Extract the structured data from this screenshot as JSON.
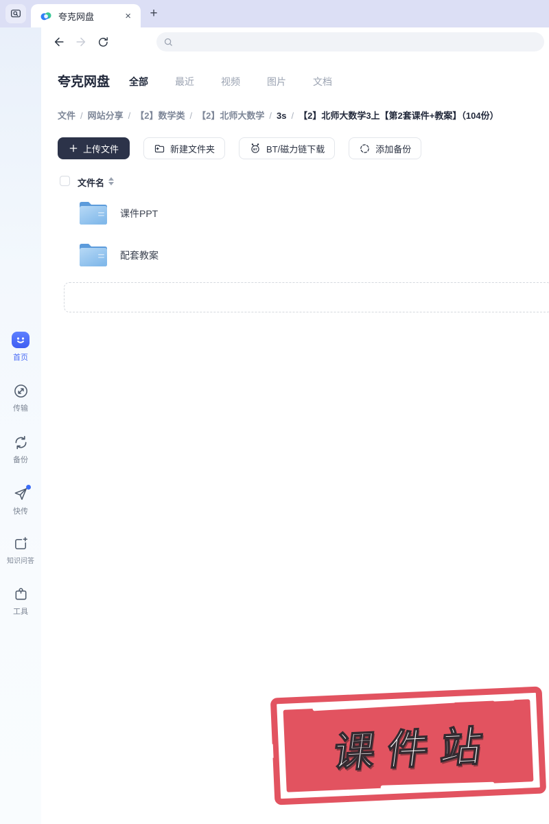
{
  "browser": {
    "tab": {
      "title": "夸克网盘",
      "close": "×"
    },
    "new_tab": "+",
    "search_value": ""
  },
  "header": {
    "title": "夸克网盘",
    "tabs": [
      {
        "label": "全部"
      },
      {
        "label": "最近"
      },
      {
        "label": "视频"
      },
      {
        "label": "图片"
      },
      {
        "label": "文档"
      }
    ]
  },
  "breadcrumb": {
    "separator": "/",
    "items": [
      {
        "label": "文件"
      },
      {
        "label": "网站分享"
      },
      {
        "label": "【2】数学类"
      },
      {
        "label": "【2】北师大数学"
      },
      {
        "label": "3s"
      },
      {
        "label": "【2】北师大数学3上【第2套课件+教案】（104份）"
      }
    ]
  },
  "toolbar": {
    "upload": "上传文件",
    "new_folder": "新建文件夹",
    "bt_download": "BT/磁力链下载",
    "add_backup": "添加备份",
    "bt_icon_text": "BT"
  },
  "file_list": {
    "header": "文件名",
    "rows": [
      {
        "name": "课件PPT",
        "type": "folder"
      },
      {
        "name": "配套教案",
        "type": "folder"
      }
    ]
  },
  "sidebar": {
    "items": [
      {
        "label": "首页",
        "active": true
      },
      {
        "label": "传输"
      },
      {
        "label": "备份"
      },
      {
        "label": "快传",
        "badge": true
      },
      {
        "label": "知识问答"
      },
      {
        "label": "工具"
      }
    ]
  },
  "stamp": {
    "text": "课件站"
  },
  "colors": {
    "accent_blue": "#4a6cf5",
    "stamp_red": "#e25360",
    "primary_button": "#2c3349",
    "folder_blue": "#5f9edd",
    "tabbar_bg": "#dcdff5"
  }
}
